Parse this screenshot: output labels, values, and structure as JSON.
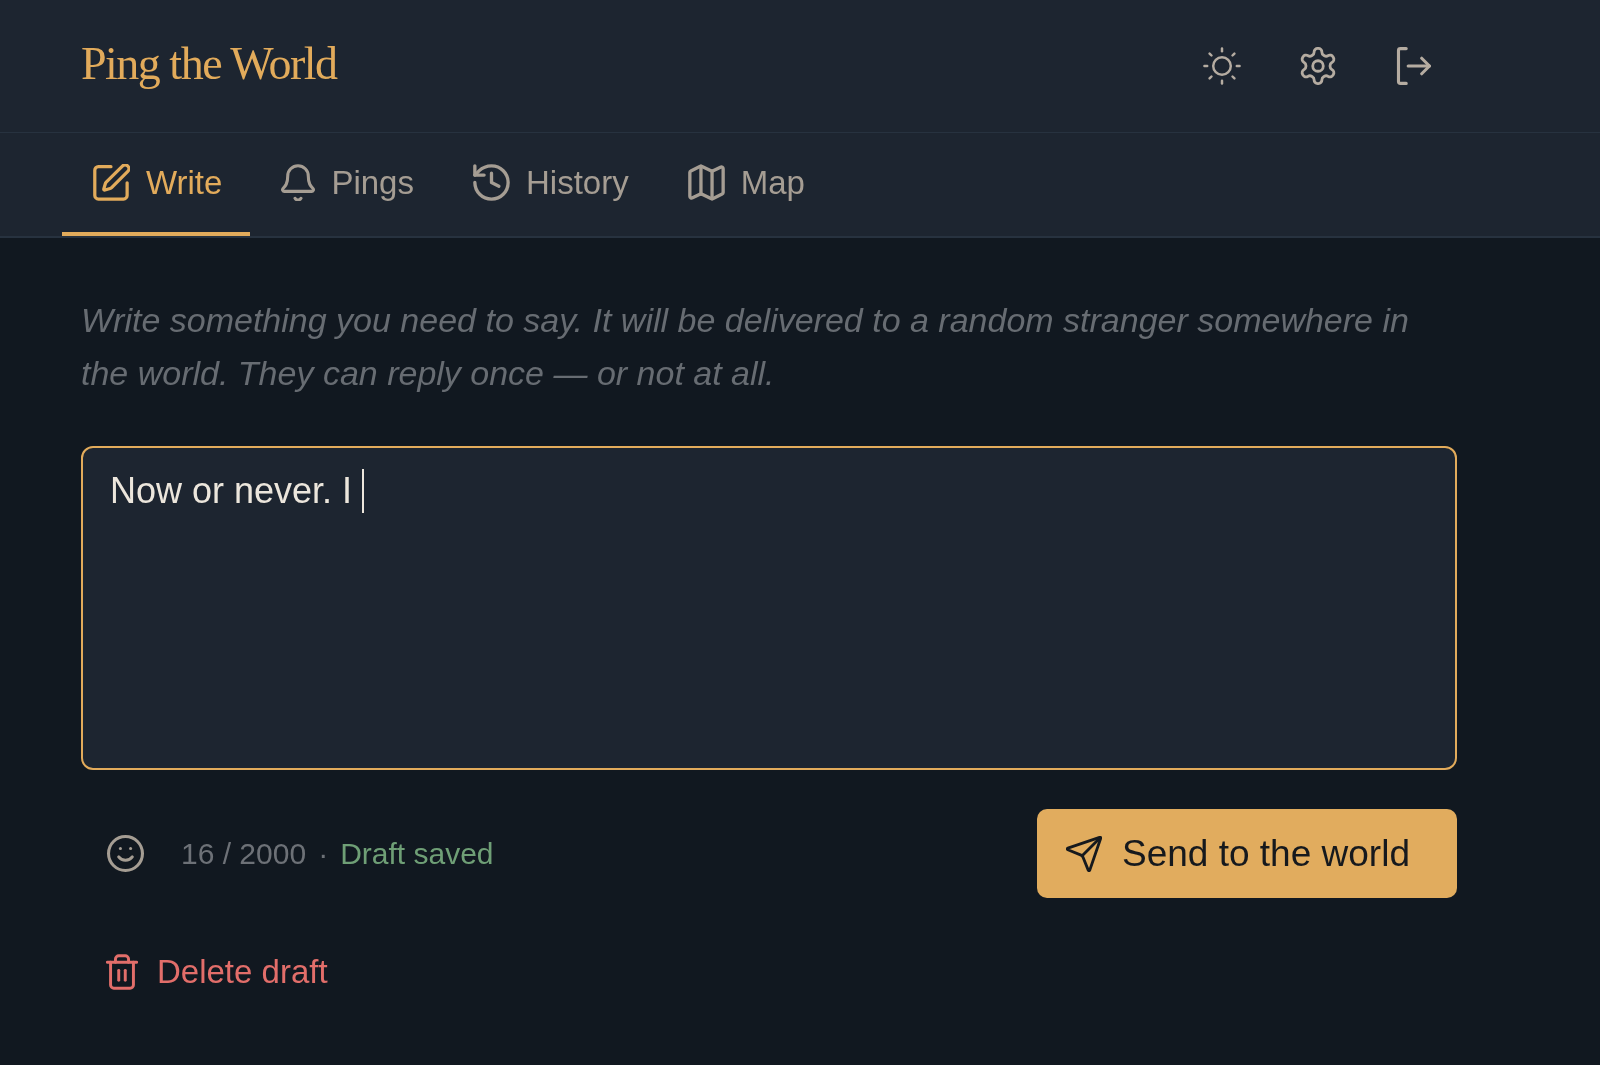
{
  "header": {
    "logo": "Ping the World"
  },
  "tabs": [
    {
      "label": "Write",
      "selected": true
    },
    {
      "label": "Pings",
      "selected": false
    },
    {
      "label": "History",
      "selected": false
    },
    {
      "label": "Map",
      "selected": false
    }
  ],
  "compose": {
    "intro": "Write something you need to say. It will be delivered to a random stranger somewhere in the world. They can reply once — or not at all.",
    "message": {
      "value": "Now or never. I",
      "focused": true
    },
    "char_count": "16 / 2000",
    "separator": "·",
    "draft_status": "Draft saved",
    "send_button": "Send to the world",
    "delete_button": "Delete draft"
  }
}
